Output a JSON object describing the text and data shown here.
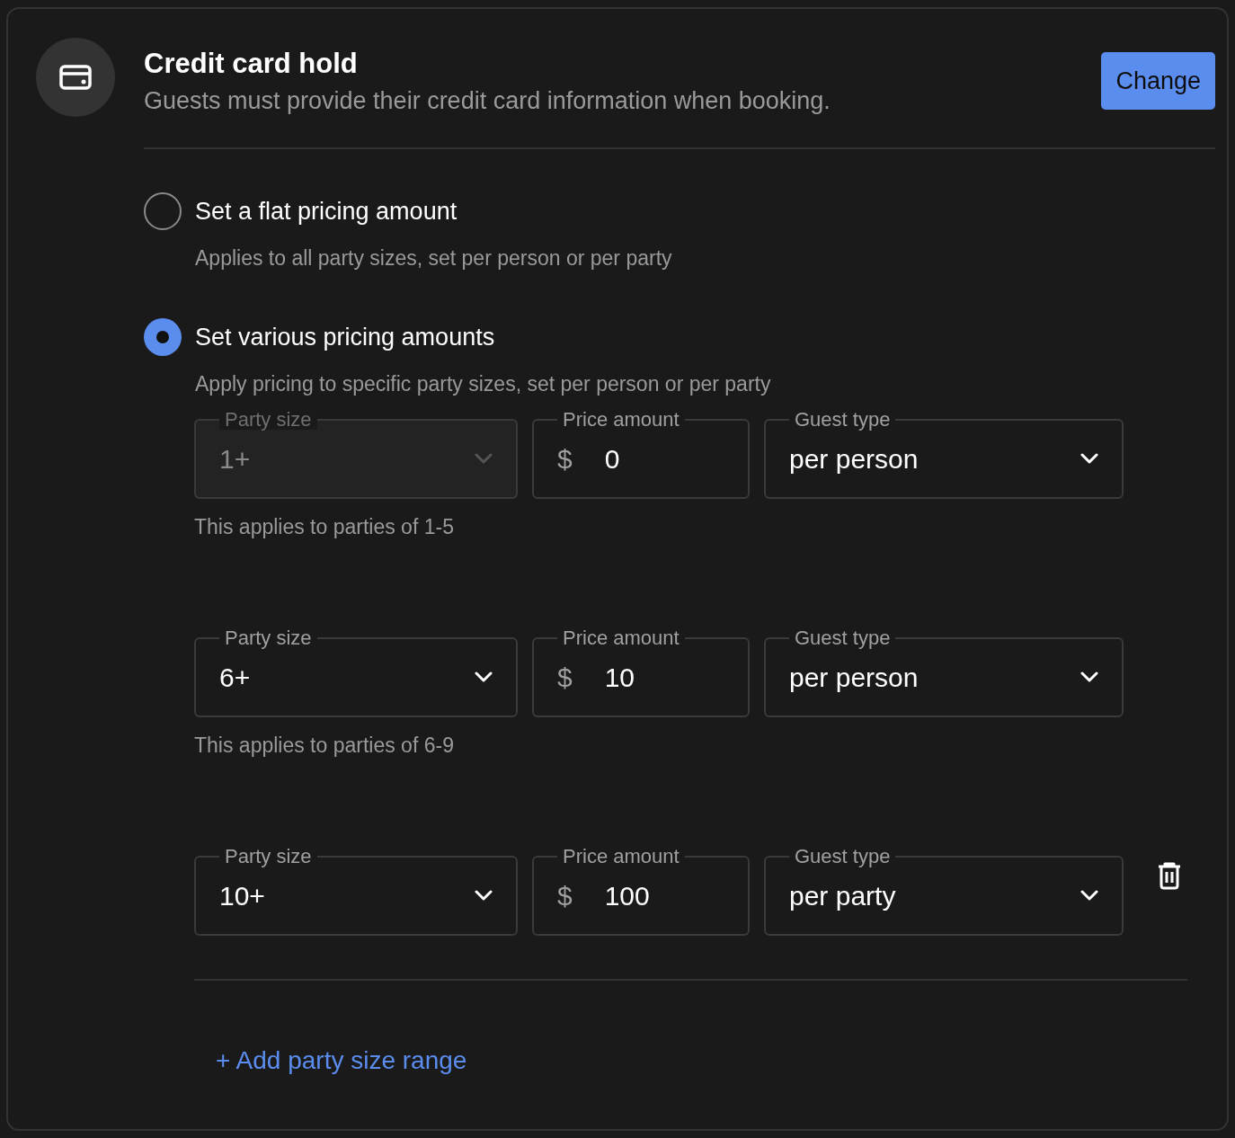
{
  "header": {
    "title": "Credit card hold",
    "subtitle": "Guests must provide their credit card information when booking.",
    "button": "Change"
  },
  "options": [
    {
      "label": "Set a flat pricing amount",
      "description": "Applies to all party sizes, set per person or per party",
      "selected": false
    },
    {
      "label": "Set various pricing amounts",
      "description": "Apply pricing to specific party sizes, set per person or per party",
      "selected": true
    }
  ],
  "ranges": [
    {
      "party_size": {
        "label": "Party size",
        "value": "1+",
        "disabled": true
      },
      "price": {
        "label": "Price amount",
        "currency": "$",
        "value": "0"
      },
      "guest_type": {
        "label": "Guest type",
        "value": "per person"
      },
      "helper": "This applies to parties of 1-5",
      "deletable": false
    },
    {
      "party_size": {
        "label": "Party size",
        "value": "6+",
        "disabled": false
      },
      "price": {
        "label": "Price amount",
        "currency": "$",
        "value": "10"
      },
      "guest_type": {
        "label": "Guest type",
        "value": "per person"
      },
      "helper": "This applies to parties of 6-9",
      "deletable": false
    },
    {
      "party_size": {
        "label": "Party size",
        "value": "10+",
        "disabled": false
      },
      "price": {
        "label": "Price amount",
        "currency": "$",
        "value": "100"
      },
      "guest_type": {
        "label": "Guest type",
        "value": "per party"
      },
      "deletable": true
    }
  ],
  "add_link": "+ Add party size range"
}
